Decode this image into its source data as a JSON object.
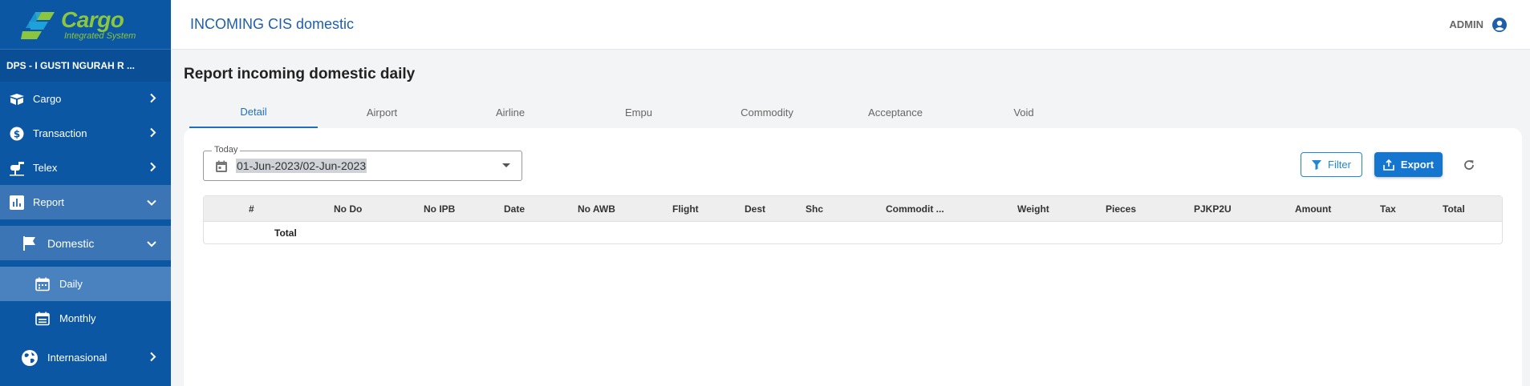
{
  "app": {
    "logo_title": "Cargo",
    "logo_subtitle": "Integrated System",
    "window_title": "INCOMING CIS domestic",
    "user": "ADMIN",
    "brand_color": "#0b57a4",
    "accent_color": "#8cc63f"
  },
  "sidebar": {
    "branch": "DPS - I GUSTI NGURAH R ...",
    "items": [
      {
        "label": "Cargo",
        "icon": "box-icon"
      },
      {
        "label": "Transaction",
        "icon": "dollar-icon"
      },
      {
        "label": "Telex",
        "icon": "mailbox-icon"
      },
      {
        "label": "Report",
        "icon": "bar-chart-icon"
      }
    ],
    "sub": {
      "label": "Domestic",
      "icon": "flag-icon"
    },
    "leaves": [
      {
        "label": "Daily",
        "icon": "calendar-icon"
      },
      {
        "label": "Monthly",
        "icon": "calendar-icon"
      }
    ],
    "international": {
      "label": "Internasional",
      "icon": "globe-icon"
    }
  },
  "main": {
    "page_title": "Report incoming domestic daily",
    "tabs": [
      "Detail",
      "Airport",
      "Airline",
      "Empu",
      "Commodity",
      "Acceptance",
      "Void"
    ],
    "date_filter": {
      "legend": "Today",
      "value": "01-Jun-2023/02-Jun-2023"
    },
    "filter_label": "Filter",
    "export_label": "Export",
    "table": {
      "headers": [
        "#",
        "No Do",
        "No IPB",
        "Date",
        "No AWB",
        "Flight",
        "Dest",
        "Shc",
        "Commodit ...",
        "Weight",
        "Pieces",
        "PJKP2U",
        "Amount",
        "Tax",
        "Total"
      ],
      "total_label": "Total"
    }
  }
}
